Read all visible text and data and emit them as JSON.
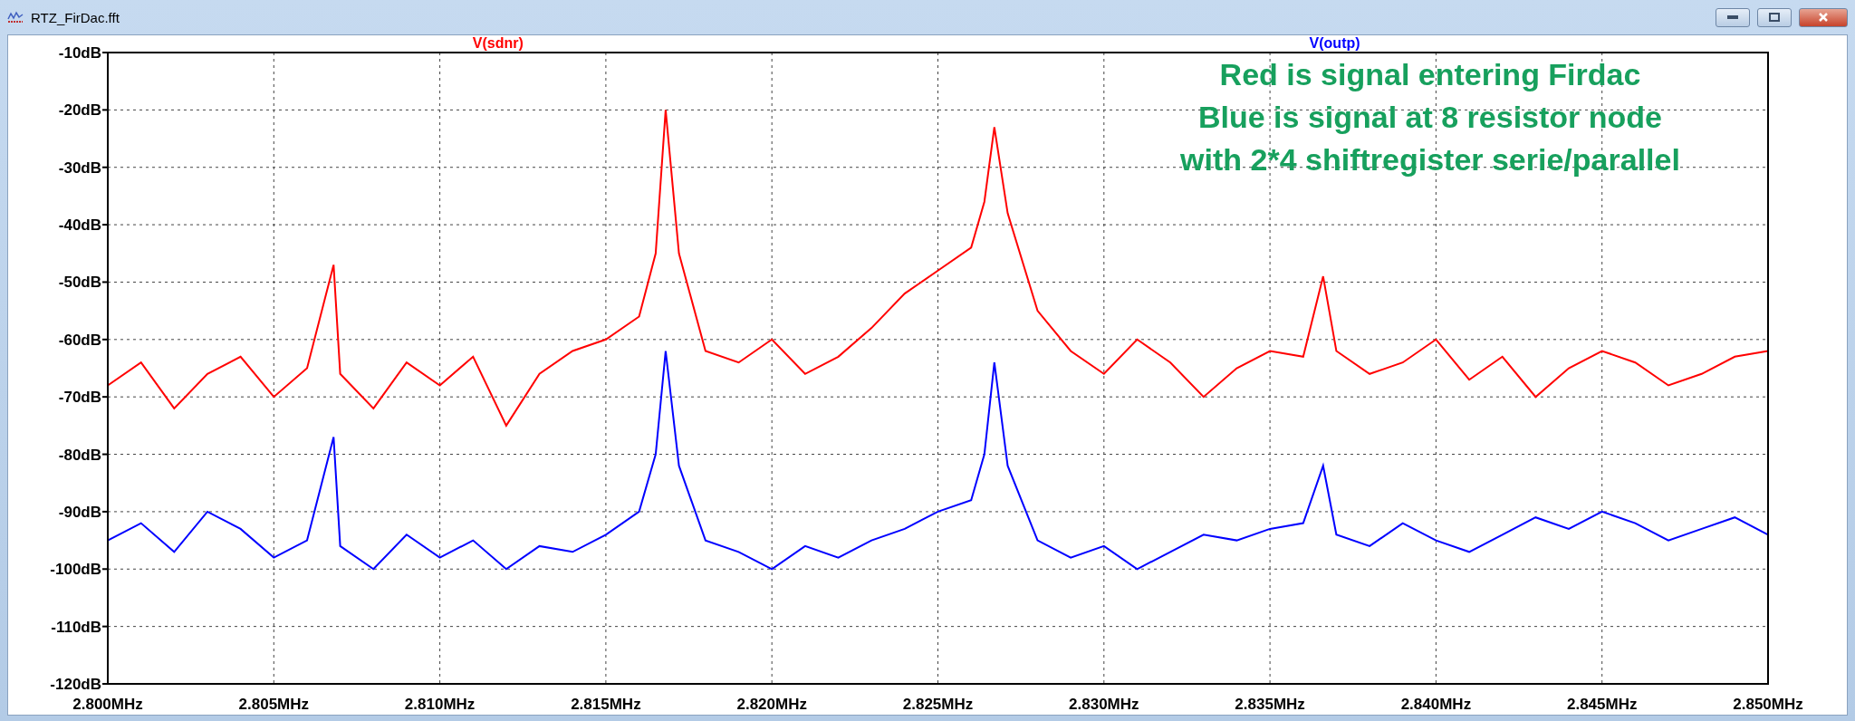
{
  "window": {
    "title": "RTZ_FirDac.fft"
  },
  "plot": {
    "chart_data": {
      "type": "line",
      "grid": true,
      "xlim": [
        2.8,
        2.85
      ],
      "ylim": [
        -120,
        -10
      ],
      "xticks": [
        {
          "value": 2.8,
          "label": "2.800MHz"
        },
        {
          "value": 2.805,
          "label": "2.805MHz"
        },
        {
          "value": 2.81,
          "label": "2.810MHz"
        },
        {
          "value": 2.815,
          "label": "2.815MHz"
        },
        {
          "value": 2.82,
          "label": "2.820MHz"
        },
        {
          "value": 2.825,
          "label": "2.825MHz"
        },
        {
          "value": 2.83,
          "label": "2.830MHz"
        },
        {
          "value": 2.835,
          "label": "2.835MHz"
        },
        {
          "value": 2.84,
          "label": "2.840MHz"
        },
        {
          "value": 2.845,
          "label": "2.845MHz"
        },
        {
          "value": 2.85,
          "label": "2.850MHz"
        }
      ],
      "yticks": [
        {
          "value": -10,
          "label": "-10dB"
        },
        {
          "value": -20,
          "label": "-20dB"
        },
        {
          "value": -30,
          "label": "-30dB"
        },
        {
          "value": -40,
          "label": "-40dB"
        },
        {
          "value": -50,
          "label": "-50dB"
        },
        {
          "value": -60,
          "label": "-60dB"
        },
        {
          "value": -70,
          "label": "-70dB"
        },
        {
          "value": -80,
          "label": "-80dB"
        },
        {
          "value": -90,
          "label": "-90dB"
        },
        {
          "value": -100,
          "label": "-100dB"
        },
        {
          "value": -110,
          "label": "-110dB"
        },
        {
          "value": -120,
          "label": "-120dB"
        }
      ],
      "x": [
        2.8,
        2.801,
        2.802,
        2.803,
        2.804,
        2.805,
        2.806,
        2.8068,
        2.807,
        2.808,
        2.809,
        2.81,
        2.811,
        2.812,
        2.813,
        2.814,
        2.815,
        2.816,
        2.8165,
        2.8168,
        2.8172,
        2.818,
        2.819,
        2.82,
        2.821,
        2.822,
        2.823,
        2.824,
        2.825,
        2.826,
        2.8264,
        2.8267,
        2.8271,
        2.828,
        2.829,
        2.83,
        2.831,
        2.832,
        2.833,
        2.834,
        2.835,
        2.836,
        2.8366,
        2.837,
        2.838,
        2.839,
        2.84,
        2.841,
        2.842,
        2.843,
        2.844,
        2.845,
        2.846,
        2.847,
        2.848,
        2.849,
        2.85
      ],
      "series": [
        {
          "name": "V(sdnr)",
          "color": "#ff0000",
          "values": [
            -68,
            -64,
            -72,
            -66,
            -63,
            -70,
            -65,
            -47,
            -66,
            -72,
            -64,
            -68,
            -63,
            -75,
            -66,
            -62,
            -60,
            -56,
            -45,
            -20,
            -45,
            -62,
            -64,
            -60,
            -66,
            -63,
            -58,
            -52,
            -48,
            -44,
            -36,
            -23,
            -38,
            -55,
            -62,
            -66,
            -60,
            -64,
            -70,
            -65,
            -62,
            -63,
            -49,
            -62,
            -66,
            -64,
            -60,
            -67,
            -63,
            -70,
            -65,
            -62,
            -64,
            -68,
            -66,
            -63,
            -62
          ]
        },
        {
          "name": "V(outp)",
          "color": "#0000ff",
          "values": [
            -95,
            -92,
            -97,
            -90,
            -93,
            -98,
            -95,
            -77,
            -96,
            -100,
            -94,
            -98,
            -95,
            -100,
            -96,
            -97,
            -94,
            -90,
            -80,
            -62,
            -82,
            -95,
            -97,
            -100,
            -96,
            -98,
            -95,
            -93,
            -90,
            -88,
            -80,
            -64,
            -82,
            -95,
            -98,
            -96,
            -100,
            -97,
            -94,
            -95,
            -93,
            -92,
            -82,
            -94,
            -96,
            -92,
            -95,
            -97,
            -94,
            -91,
            -93,
            -90,
            -92,
            -95,
            -93,
            -91,
            -94
          ]
        }
      ],
      "annotations": [
        "Red is signal entering Firdac",
        "Blue is signal at 8 resistor node",
        "with 2*4 shiftregister serie/parallel"
      ]
    }
  }
}
